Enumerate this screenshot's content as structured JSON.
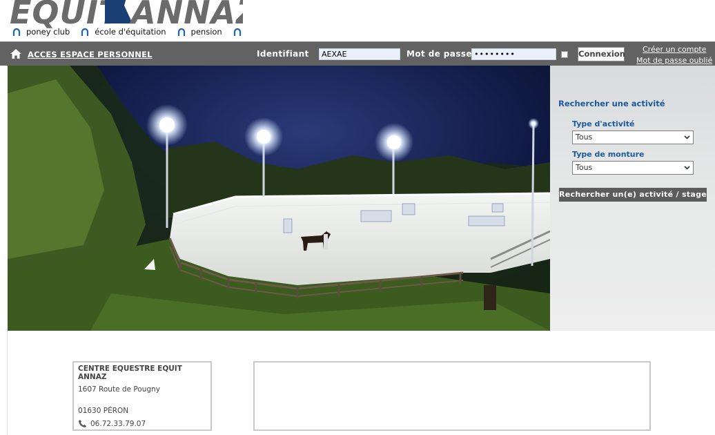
{
  "brand": {
    "logo_text": "EQUIT ANNAZ",
    "taglines": [
      "poney club",
      "école d'équitation",
      "pension"
    ]
  },
  "login_bar": {
    "espace_link": "ACCES ESPACE PERSONNEL",
    "identifiant_label": "Identifiant",
    "identifiant_value": "AEXAE",
    "password_label": "Mot de passe",
    "password_value": "••••••••",
    "connexion_label": "Connexion",
    "create_account": "Créer un compte",
    "forgot_password": "Mot de passe oublié"
  },
  "search": {
    "title": "Rechercher une activité",
    "activity_type_label": "Type d'activité",
    "activity_type_value": "Tous",
    "mount_type_label": "Type de monture",
    "mount_type_value": "Tous",
    "button_label": "Rechercher un(e) activité / stage"
  },
  "contact": {
    "name": "CENTRE EQUESTRE EQUIT ANNAZ",
    "address": "1607 Route de Pougny",
    "city": "01630 PÉRON",
    "phone": "06.72.33.79.07"
  },
  "colors": {
    "bar_bg": "#626262",
    "link_blue": "#1c5a9d",
    "logo_navy": "#1a3f74",
    "logo_grey": "#6b6b6b"
  },
  "icons": [
    "home-icon",
    "horseshoe-icon",
    "chevron-down-icon",
    "phone-icon"
  ]
}
